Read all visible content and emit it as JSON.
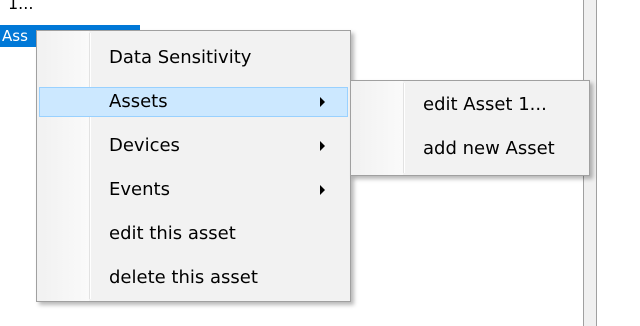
{
  "tree": {
    "top_item_label": "1...",
    "selected_item_label": "Ass"
  },
  "context_menu": {
    "items": [
      {
        "label": "Data Sensitivity",
        "has_submenu": false,
        "highlighted": false
      },
      {
        "label": "Assets",
        "has_submenu": true,
        "highlighted": true
      },
      {
        "label": "Devices",
        "has_submenu": true,
        "highlighted": false
      },
      {
        "label": "Events",
        "has_submenu": true,
        "highlighted": false
      },
      {
        "label": "edit this asset",
        "has_submenu": false,
        "highlighted": false
      },
      {
        "label": "delete this asset",
        "has_submenu": false,
        "highlighted": false
      }
    ]
  },
  "submenu": {
    "items": [
      {
        "label": "edit Asset 1..."
      },
      {
        "label": "add new Asset"
      }
    ]
  },
  "colors": {
    "selection_blue": "#0078d7",
    "menu_background": "#f2f2f2",
    "menu_highlight": "#cce8ff",
    "menu_highlight_border": "#99d1ff"
  }
}
